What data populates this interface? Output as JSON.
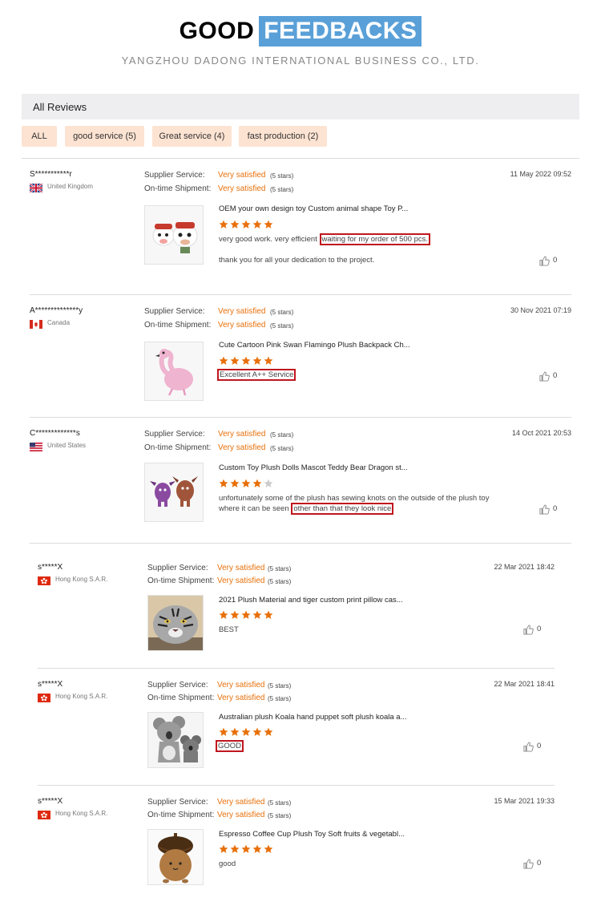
{
  "header": {
    "title_a": "GOOD",
    "title_b": "FEEDBACKS",
    "subtitle": "YANGZHOU DADONG INTERNATIONAL BUSINESS CO., LTD."
  },
  "all_reviews_label": "All Reviews",
  "filters": [
    {
      "label": "ALL"
    },
    {
      "label": "good service (5)"
    },
    {
      "label": "Great service (4)"
    },
    {
      "label": "fast production (2)"
    }
  ],
  "labels": {
    "supplier_service": "Supplier Service:",
    "on_time_shipment": "On-time Shipment:"
  },
  "colors": {
    "accent": "#e8700a",
    "highlight": "#c0161e",
    "title_bg": "#5aa0d8",
    "chip_bg": "#fde3d2"
  },
  "reviews": [
    {
      "name": "S***********r",
      "country": "United Kingdom",
      "flag": "uk-flag-icon",
      "supplier_service": "Very satisfied",
      "supplier_stars": "(5 stars)",
      "shipment": "Very satisfied",
      "shipment_stars": "(5 stars)",
      "date": "11 May 2022 09:52",
      "product": "OEM your own design toy Custom animal shape Toy P...",
      "rating": 5,
      "text_a": "very good work. very efficient ",
      "text_hl": "waiting for my order of 500 pcs.",
      "text_b": "thank you for all your dedication to the project.",
      "likes": "0"
    },
    {
      "name": "A**************y",
      "country": "Canada",
      "flag": "canada-flag-icon",
      "supplier_service": "Very satisfied",
      "supplier_stars": "(5 stars)",
      "shipment": "Very satisfied",
      "shipment_stars": "(5 stars)",
      "date": "30 Nov 2021 07:19",
      "product": "Cute Cartoon Pink Swan Flamingo Plush Backpack Ch...",
      "rating": 5,
      "text_hl": "Excellent A++ Service",
      "likes": "0"
    },
    {
      "name": "C*************s",
      "country": "United States",
      "flag": "us-flag-icon",
      "supplier_service": "Very satisfied",
      "supplier_stars": "(5 stars)",
      "shipment": "Very satisfied",
      "shipment_stars": "(5 stars)",
      "date": "14 Oct 2021 20:53",
      "product": "Custom Toy Plush Dolls Mascot Teddy Bear Dragon st...",
      "rating": 4,
      "text_a": "unfortunately some of the plush has sewing knots on the outside of the plush toy",
      "text_b": "where it can be seen ",
      "text_hl": "other than that they look nice",
      "likes": "0"
    },
    {
      "name": "s*****X",
      "country": "Hong Kong S.A.R.",
      "flag": "hk-flag-icon",
      "supplier_service": "Very satisfied",
      "supplier_stars": "(5 stars)",
      "shipment": "Very satisfied",
      "shipment_stars": "(5 stars)",
      "date": "22 Mar 2021 18:42",
      "product": "2021 Plush Material and tiger custom print pillow cas...",
      "rating": 5,
      "text_a": "BEST",
      "likes": "0"
    },
    {
      "name": "s*****X",
      "country": "Hong Kong S.A.R.",
      "flag": "hk-flag-icon",
      "supplier_service": "Very satisfied",
      "supplier_stars": "(5 stars)",
      "shipment": "Very satisfied",
      "shipment_stars": "(5 stars)",
      "date": "22 Mar 2021 18:41",
      "product": "Australian plush Koala hand puppet soft plush koala a...",
      "rating": 5,
      "text_hl": "GOOD",
      "likes": "0"
    },
    {
      "name": "s*****X",
      "country": "Hong Kong S.A.R.",
      "flag": "hk-flag-icon",
      "supplier_service": "Very satisfied",
      "supplier_stars": "(5 stars)",
      "shipment": "Very satisfied",
      "shipment_stars": "(5 stars)",
      "date": "15 Mar 2021 19:33",
      "product": "Espresso Coffee Cup Plush Toy Soft fruits & vegetabl...",
      "rating": 5,
      "text_a": "good",
      "likes": "0"
    }
  ]
}
